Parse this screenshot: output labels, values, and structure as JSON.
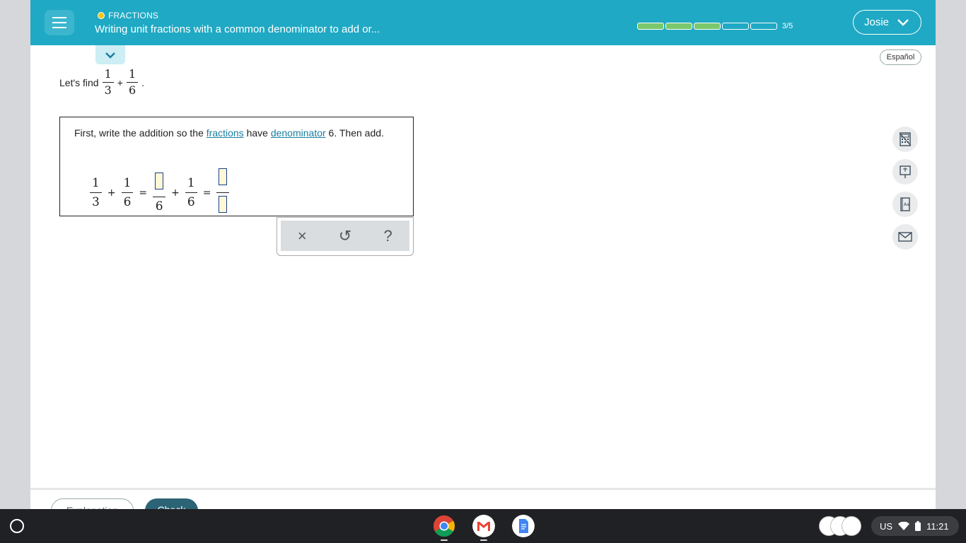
{
  "header": {
    "topic": "FRACTIONS",
    "lesson_title": "Writing unit fractions with a common denominator to add or...",
    "progress_text": "3/5",
    "progress_filled": 3,
    "progress_total": 5,
    "user_name": "Josie"
  },
  "language_button": "Español",
  "prompt": {
    "lead": "Let's find",
    "frac1": {
      "num": "1",
      "den": "3"
    },
    "op": "+",
    "frac2": {
      "num": "1",
      "den": "6"
    },
    "end": "."
  },
  "problem": {
    "instr_part1": "First, write the addition so the",
    "link1": "fractions",
    "instr_part2": "have",
    "link2": "denominator",
    "instr_part3": "6. Then add.",
    "eq": {
      "f1": {
        "num": "1",
        "den": "3"
      },
      "plus": "+",
      "f2": {
        "num": "1",
        "den": "6"
      },
      "equals": "=",
      "f3_den": "6",
      "f4": {
        "num": "1",
        "den": "6"
      }
    }
  },
  "tools": {
    "clear": "×",
    "undo": "↺",
    "help": "?"
  },
  "bottom": {
    "explanation_label": "Explanation",
    "check_label": "Check"
  },
  "system": {
    "region": "US",
    "time": "11:21"
  },
  "colors": {
    "header_bg": "#1fa9c4",
    "progress_fill": "#7bc86c",
    "link": "#1a7fa0",
    "check_bg": "#2c6476"
  }
}
